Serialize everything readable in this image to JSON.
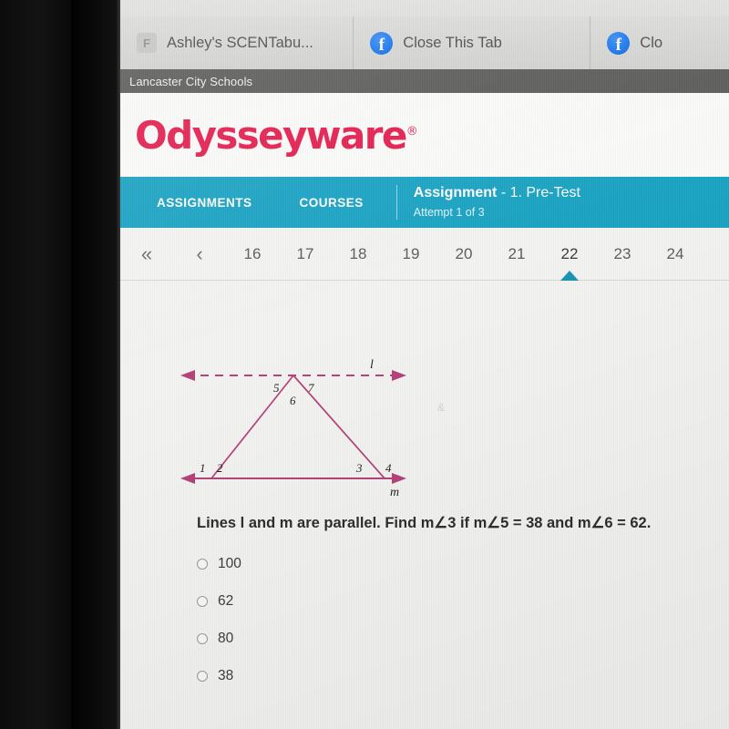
{
  "browser": {
    "tabs": [
      {
        "favicon": "generic-favicon",
        "favicon_letter": "F",
        "title": "Ashley's SCENTabu..."
      },
      {
        "favicon": "facebook-icon",
        "favicon_letter": "f",
        "title": "Close This Tab"
      },
      {
        "favicon": "facebook-icon",
        "favicon_letter": "f",
        "title": "Clo"
      }
    ],
    "bookmarks": [
      {
        "label": "Lancaster City Schools"
      }
    ]
  },
  "site": {
    "logo_text": "Odysseyware",
    "logo_registered": "®",
    "brand_red": "#e51a4c",
    "brand_teal": "#18a3c3"
  },
  "navbar": {
    "assignments_label": "ASSIGNMENTS",
    "courses_label": "COURSES",
    "assignment_label": "Assignment",
    "assignment_name": "- 1. Pre-Test",
    "attempt_text": "Attempt 1 of 3"
  },
  "pagination": {
    "first_arrow": "«",
    "prev_arrow": "‹",
    "numbers": [
      "16",
      "17",
      "18",
      "19",
      "20",
      "21",
      "22",
      "23",
      "24"
    ],
    "active": "22"
  },
  "question": {
    "text": "Lines l and m are parallel. Find m∠3 if m∠5 = 38 and m∠6 = 62.",
    "options": [
      {
        "label": "100",
        "selected": false
      },
      {
        "label": "62",
        "selected": false
      },
      {
        "label": "80",
        "selected": false
      },
      {
        "label": "38",
        "selected": false
      }
    ]
  },
  "diagram": {
    "line_color": "#b5407a",
    "top_line_label": "l",
    "top_line_style": "dashed",
    "bottom_line_label": "m",
    "bottom_line_style": "solid",
    "angle_labels": [
      "1",
      "2",
      "3",
      "4",
      "5",
      "6",
      "7"
    ],
    "description": "Triangle between two parallel lines with seven numbered angles"
  }
}
